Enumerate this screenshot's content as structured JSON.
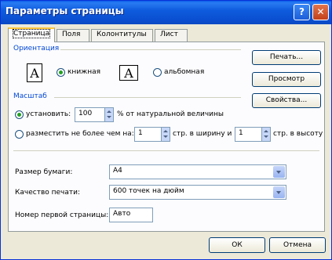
{
  "window": {
    "title": "Параметры страницы",
    "help_glyph": "?",
    "close_glyph": "✕"
  },
  "tabs": [
    {
      "label": "Страница",
      "active": true
    },
    {
      "label": "Поля",
      "active": false
    },
    {
      "label": "Колонтитулы",
      "active": false
    },
    {
      "label": "Лист",
      "active": false
    }
  ],
  "orientation": {
    "group_label": "Ориентация",
    "portrait_icon": "A",
    "portrait_label": "книжная",
    "landscape_icon": "A",
    "landscape_label": "альбомная",
    "selected": "portrait"
  },
  "scale": {
    "group_label": "Масштаб",
    "set_label": "установить:",
    "set_value": "100",
    "set_suffix": "% от натуральной величины",
    "fit_label": "разместить не более чем на:",
    "fit_wide": "1",
    "fit_wide_suffix": "стр. в ширину и",
    "fit_tall": "1",
    "fit_tall_suffix": "стр. в высоту",
    "selected": "set"
  },
  "paper_size": {
    "label": "Размер бумаги:",
    "value": "A4"
  },
  "print_quality": {
    "label": "Качество печати:",
    "value": "600 точек на дюйм"
  },
  "first_page": {
    "label": "Номер первой страницы:",
    "value": "Авто"
  },
  "side_buttons": {
    "print": "Печать...",
    "preview": "Просмотр",
    "properties": "Свойства..."
  },
  "footer": {
    "ok": "ОК",
    "cancel": "Отмена"
  }
}
